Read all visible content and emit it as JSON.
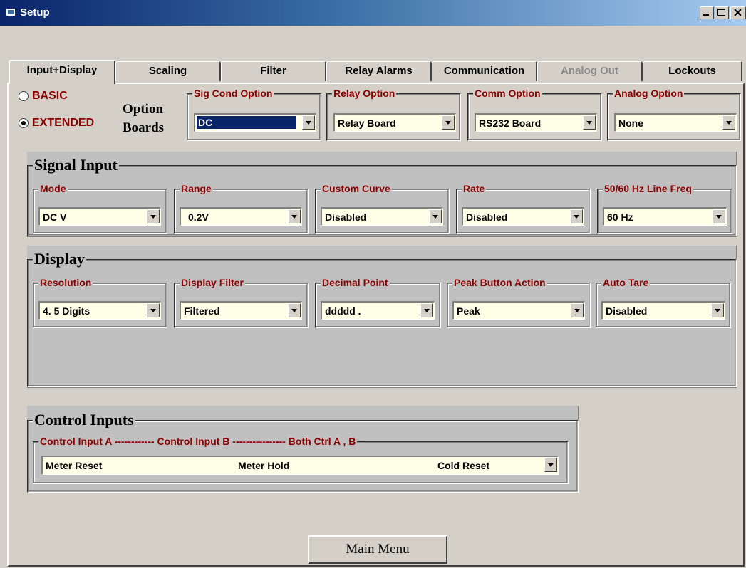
{
  "window": {
    "title": "Setup"
  },
  "tabs": [
    {
      "label": "Input+Display",
      "state": "active"
    },
    {
      "label": "Scaling",
      "state": "normal"
    },
    {
      "label": "Filter",
      "state": "normal"
    },
    {
      "label": "Relay Alarms",
      "state": "normal"
    },
    {
      "label": "Communication",
      "state": "normal"
    },
    {
      "label": "Analog Out",
      "state": "disabled"
    },
    {
      "label": "Lockouts",
      "state": "normal"
    }
  ],
  "mode_radios": {
    "basic_label": "BASIC",
    "extended_label": "EXTENDED",
    "selected": "EXTENDED"
  },
  "option_boards": {
    "label_line1": "Option",
    "label_line2": "Boards",
    "sig_cond": {
      "legend": "Sig Cond Option",
      "value": "DC"
    },
    "relay": {
      "legend": "Relay Option",
      "value": "Relay Board"
    },
    "comm": {
      "legend": "Comm Option",
      "value": "RS232 Board"
    },
    "analog": {
      "legend": "Analog Option",
      "value": "None"
    }
  },
  "signal_input": {
    "title": "Signal Input",
    "mode": {
      "legend": "Mode",
      "value": "DC V"
    },
    "range": {
      "legend": "Range",
      "value": "0.2V"
    },
    "custom_curve": {
      "legend": "Custom Curve",
      "value": "Disabled"
    },
    "rate": {
      "legend": "Rate",
      "value": "Disabled"
    },
    "line_freq": {
      "legend": "50/60 Hz Line Freq",
      "value": "60 Hz"
    }
  },
  "display": {
    "title": "Display",
    "resolution": {
      "legend": "Resolution",
      "value": "4. 5 Digits"
    },
    "display_filter": {
      "legend": "Display Filter",
      "value": "Filtered"
    },
    "decimal_point": {
      "legend": "Decimal Point",
      "value": "ddddd ."
    },
    "peak_button": {
      "legend": "Peak Button Action",
      "value": "Peak"
    },
    "auto_tare": {
      "legend": "Auto Tare",
      "value": "Disabled"
    }
  },
  "control_inputs": {
    "title": "Control Inputs",
    "legend": "Control Input A ------------ Control Input B ---------------- Both Ctrl A , B",
    "input_a": "Meter Reset",
    "input_b": "Meter Hold",
    "both": "Cold Reset"
  },
  "footer": {
    "main_menu_label": "Main Menu"
  },
  "colors": {
    "titlebar_start": "#0a246a",
    "titlebar_end": "#a6caf0",
    "legend_red": "#8b0000",
    "combo_bg": "#ffffe8",
    "section_bg": "#c0c0c0",
    "face": "#d4d0c8"
  }
}
